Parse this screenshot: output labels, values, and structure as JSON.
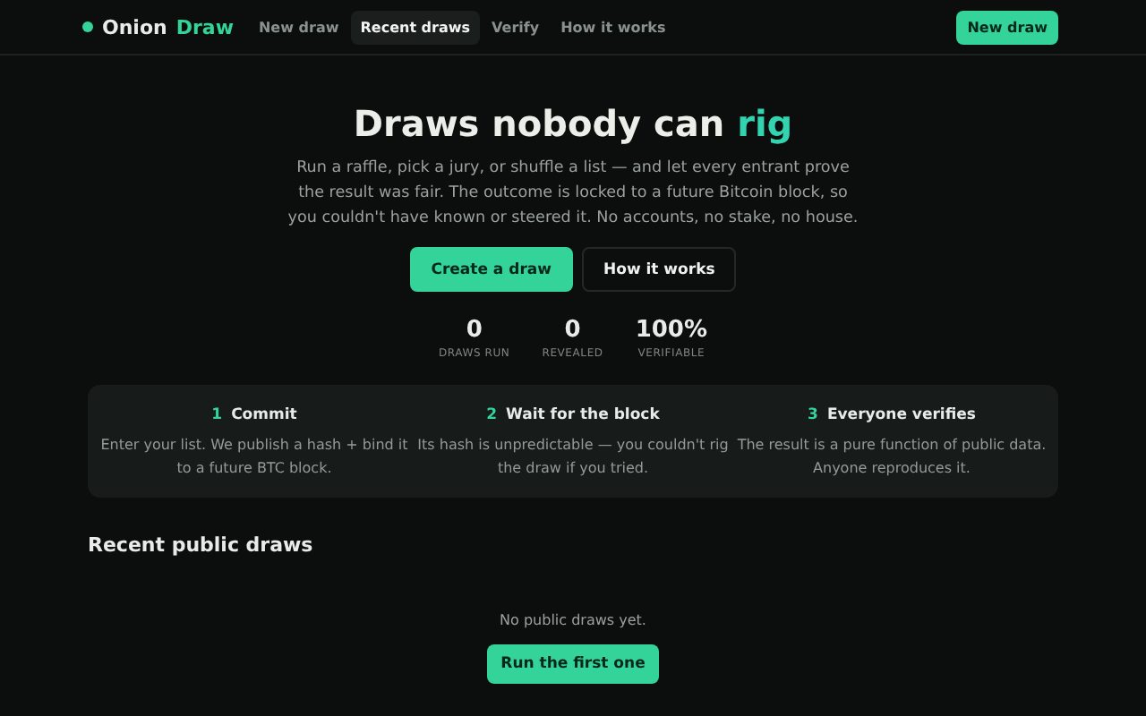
{
  "nav": {
    "brand": {
      "name": "Onion",
      "accent": "Draw"
    },
    "links": [
      {
        "label": "New draw",
        "selected": false
      },
      {
        "label": "Recent draws",
        "selected": true
      },
      {
        "label": "Verify",
        "selected": false
      },
      {
        "label": "How it works",
        "selected": false
      }
    ],
    "action": "New draw"
  },
  "hero": {
    "title": "Draws nobody can",
    "title_accent": "rig",
    "text": "Run a raffle, pick a jury, or shuffle a list — and let every entrant prove the result was fair. The outcome is locked to a future Bitcoin block, so you couldn't have known or steered it. No accounts, no stake, no house.",
    "buttons": [
      {
        "label": "Create a draw",
        "kind": "primary"
      },
      {
        "label": "How it works",
        "kind": "secondary"
      }
    ]
  },
  "stats": [
    {
      "value": "0",
      "label": "DRAWS RUN"
    },
    {
      "value": "0",
      "label": "REVEALED"
    },
    {
      "value": "100%",
      "label": "VERIFIABLE"
    }
  ],
  "steps": [
    {
      "number": "1",
      "title": "Commit",
      "text": "Enter your list. We publish a hash + bind it to a future BTC block."
    },
    {
      "number": "2",
      "title": "Wait for the block",
      "text": "Its hash is unpredictable — you couldn't rig the draw if you tried."
    },
    {
      "number": "3",
      "title": "Everyone verifies",
      "text": "The result is a pure function of public data. Anyone reproduces it."
    }
  ],
  "recent": {
    "title": "Recent public draws",
    "empty_text": "No public draws yet.",
    "button": "Run the first one"
  }
}
